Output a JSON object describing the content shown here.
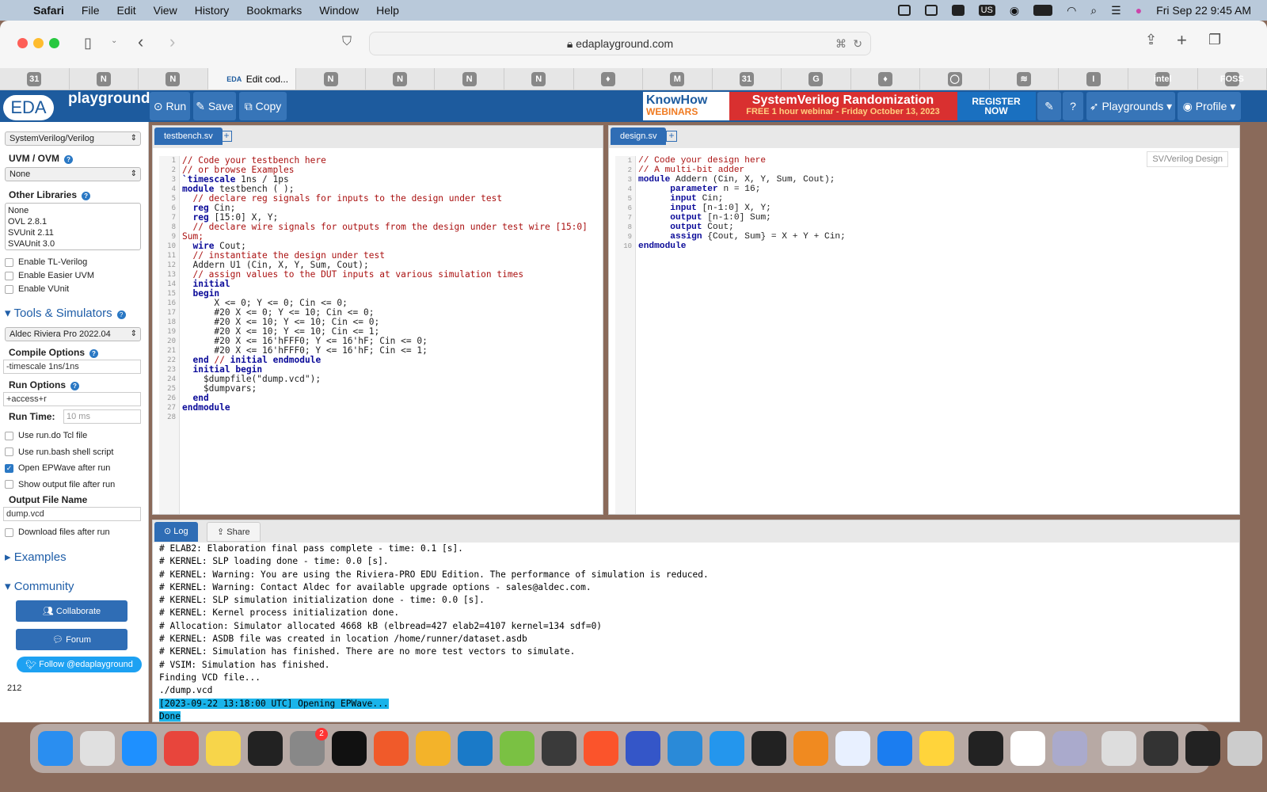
{
  "menubar": {
    "app": "Safari",
    "items": [
      "File",
      "Edit",
      "View",
      "History",
      "Bookmarks",
      "Window",
      "Help"
    ],
    "keyboard": "US",
    "datetime": "Fri Sep 22  9:45 AM"
  },
  "safari": {
    "url": "edaplayground.com",
    "active_tab": "Edit cod...",
    "tabs": [
      "31",
      "N",
      "N",
      "EDA",
      "N",
      "N",
      "N",
      "N",
      "♦",
      "M",
      "31",
      "G",
      "♦",
      "◯",
      "≋",
      "I",
      "intel",
      "FOSS"
    ]
  },
  "header": {
    "logo_top": "playground",
    "logo_main": "EDA",
    "run": "Run",
    "save": "Save",
    "copy": "Copy",
    "banner": {
      "brand": "KnowHow",
      "brand_sub": "WEBINARS",
      "title": "SystemVerilog Randomization",
      "subtitle": "FREE 1 hour webinar - Friday October 13, 2023",
      "cta": "REGISTER NOW"
    },
    "playgrounds": "Playgrounds",
    "profile": "Profile"
  },
  "sidebar": {
    "language": "SystemVerilog/Verilog",
    "uvm_label": "UVM / OVM",
    "uvm_value": "None",
    "libs_label": "Other Libraries",
    "libs": [
      "None",
      "OVL 2.8.1",
      "SVUnit 2.11",
      "SVAUnit 3.0"
    ],
    "checks1": [
      {
        "label": "Enable TL-Verilog",
        "checked": false
      },
      {
        "label": "Enable Easier UVM",
        "checked": false
      },
      {
        "label": "Enable VUnit",
        "checked": false
      }
    ],
    "tools_label": "Tools & Simulators",
    "simulator": "Aldec Riviera Pro 2022.04",
    "compile_label": "Compile Options",
    "compile_value": "-timescale 1ns/1ns",
    "run_opts_label": "Run Options",
    "run_opts_value": "+access+r",
    "runtime_label": "Run Time:",
    "runtime_placeholder": "10 ms",
    "checks2": [
      {
        "label": "Use run.do Tcl file",
        "checked": false
      },
      {
        "label": "Use run.bash shell script",
        "checked": false
      },
      {
        "label": "Open EPWave after run",
        "checked": true
      },
      {
        "label": "Show output file after run",
        "checked": false
      }
    ],
    "output_label": "Output File Name",
    "output_value": "dump.vcd",
    "download": "Download files after run",
    "examples": "Examples",
    "community": "Community",
    "collaborate": "Collaborate",
    "forum": "Forum",
    "follow": "Follow @edaplayground",
    "count": "212"
  },
  "testbench": {
    "tab": "testbench.sv",
    "lines": [
      "// Code your testbench here",
      "// or browse Examples",
      "",
      "`timescale 1ns / 1ps",
      "module testbench ( );",
      "  // declare reg signals for inputs to the design under test",
      "  reg Cin;",
      "  reg [15:0] X, Y;",
      "  // declare wire signals for outputs from the design under test wire [15:0]\nSum;",
      "  wire Cout;",
      "  // instantiate the design under test",
      "",
      "  Addern U1 (Cin, X, Y, Sum, Cout);",
      "  // assign values to the DUT inputs at various simulation times",
      "  initial",
      "  begin",
      "      X <= 0; Y <= 0; Cin <= 0;",
      "      #20 X <= 0; Y <= 10; Cin <= 0;",
      "      #20 X <= 10; Y <= 10; Cin <= 0;",
      "      #20 X <= 10; Y <= 10; Cin <= 1;",
      "      #20 X <= 16'hFFF0; Y <= 16'hF; Cin <= 0;",
      "      #20 X <= 16'hFFF0; Y <= 16'hF; Cin <= 1;",
      "  end // initial endmodule",
      "  initial begin",
      "    $dumpfile(\"dump.vcd\");",
      "    $dumpvars;",
      "  end",
      "endmodule"
    ]
  },
  "design": {
    "tab": "design.sv",
    "lang_badge": "SV/Verilog Design",
    "lines": [
      "// Code your design here",
      "// A multi-bit adder",
      "module Addern (Cin, X, Y, Sum, Cout);",
      "      parameter n = 16;",
      "      input Cin;",
      "      input [n-1:0] X, Y;",
      "      output [n-1:0] Sum;",
      "      output Cout;",
      "      assign {Cout, Sum} = X + Y + Cin;",
      "endmodule"
    ]
  },
  "log": {
    "tab_log": "Log",
    "tab_share": "Share",
    "lines": [
      "# ELAB2: Elaboration final pass complete - time: 0.1 [s].",
      "# KERNEL: SLP loading done - time: 0.0 [s].",
      "# KERNEL: Warning: You are using the Riviera-PRO EDU Edition. The performance of simulation is reduced.",
      "# KERNEL: Warning: Contact Aldec for available upgrade options - sales@aldec.com.",
      "# KERNEL: SLP simulation initialization done - time: 0.0 [s].",
      "# KERNEL: Kernel process initialization done.",
      "# Allocation: Simulator allocated 4668 kB (elbread=427 elab2=4107 kernel=134 sdf=0)",
      "# KERNEL: ASDB file was created in location /home/runner/dataset.asdb",
      "# KERNEL: Simulation has finished. There are no more test vectors to simulate.",
      "# VSIM: Simulation has finished.",
      "Finding VCD file...",
      "./dump.vcd"
    ],
    "highlighted": [
      "[2023-09-22 13:18:00 UTC] Opening EPWave...",
      "Done"
    ]
  },
  "dock": {
    "items": [
      {
        "name": "finder",
        "color": "#2a8ef0"
      },
      {
        "name": "launchpad",
        "color": "#e0e0e0"
      },
      {
        "name": "safari",
        "color": "#1e90ff"
      },
      {
        "name": "chrome",
        "color": "#e8453c"
      },
      {
        "name": "notes",
        "color": "#f7d54a"
      },
      {
        "name": "terminal",
        "color": "#222"
      },
      {
        "name": "system-settings",
        "color": "#888",
        "badge": "2"
      },
      {
        "name": "intellij",
        "color": "#111"
      },
      {
        "name": "paw",
        "color": "#f05a2a"
      },
      {
        "name": "colorpicker",
        "color": "#f3b32a"
      },
      {
        "name": "wireshark",
        "color": "#1a7ac8"
      },
      {
        "name": "postman",
        "color": "#7ac143"
      },
      {
        "name": "sublime",
        "color": "#3a3a3a"
      },
      {
        "name": "brave",
        "color": "#fb542b"
      },
      {
        "name": "app-generic",
        "color": "#3456c8"
      },
      {
        "name": "vscode",
        "color": "#2a8ad8"
      },
      {
        "name": "docker",
        "color": "#2496ed"
      },
      {
        "name": "app-dark",
        "color": "#222"
      },
      {
        "name": "fl-studio",
        "color": "#f08a20"
      },
      {
        "name": "proxyman",
        "color": "#e8f0ff"
      },
      {
        "name": "xcode",
        "color": "#1b7df0"
      },
      {
        "name": "python",
        "color": "#ffd43b"
      },
      {
        "name": "activity-monitor",
        "color": "#222"
      },
      {
        "name": "slack",
        "color": "#ffffff"
      },
      {
        "name": "preview",
        "color": "#aac"
      },
      {
        "name": "archive",
        "color": "#ddd"
      },
      {
        "name": "window-1",
        "color": "#333"
      },
      {
        "name": "window-2",
        "color": "#222"
      },
      {
        "name": "trash",
        "color": "#ccc"
      }
    ]
  }
}
